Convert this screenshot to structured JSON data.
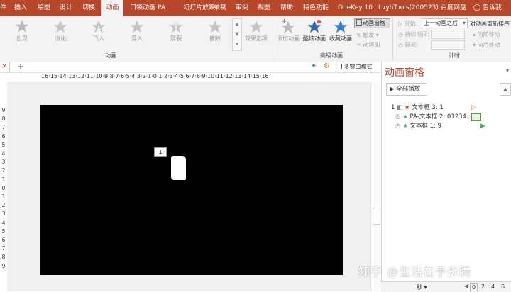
{
  "tabs": [
    {
      "label": "件",
      "active": false
    },
    {
      "label": "插入",
      "active": false
    },
    {
      "label": "绘图",
      "active": false
    },
    {
      "label": "设计",
      "active": false
    },
    {
      "label": "切换",
      "active": false
    },
    {
      "label": "动画",
      "active": true
    },
    {
      "label": "口袋动画 PA",
      "active": false
    },
    {
      "label": "幻灯片放映",
      "active": false
    },
    {
      "label": "录制",
      "active": false
    },
    {
      "label": "审阅",
      "active": false
    },
    {
      "label": "视图",
      "active": false
    },
    {
      "label": "帮助",
      "active": false
    },
    {
      "label": "特色功能",
      "active": false
    },
    {
      "label": "OneKey 10",
      "active": false
    },
    {
      "label": "LvyhTools(200523)",
      "active": false
    },
    {
      "label": "百度网盘",
      "active": false
    }
  ],
  "tellme": "告诉我",
  "ribbon": {
    "effects": [
      {
        "label": "出现"
      },
      {
        "label": "淡化"
      },
      {
        "label": "飞入"
      },
      {
        "label": "浮入"
      },
      {
        "label": "劈裂"
      },
      {
        "label": "擦除"
      }
    ],
    "effect_options": "效果选项",
    "group_animation": "动画",
    "add_animation": "添加动画",
    "cool_animation": "酷炫动画",
    "collect_animation": "收藏动画",
    "animation_pane": "动画窗格",
    "trigger": "触发",
    "animation_painter": "动画刷",
    "group_advanced": "高级动画",
    "start_label": "开始:",
    "start_value": "上一动画之后",
    "duration_label": "持续时间:",
    "delay_label": "延迟:",
    "group_timing": "计时",
    "reorder_title": "对动画重新排序",
    "move_earlier": "向前移动",
    "move_later": "向后移动"
  },
  "editor": {
    "multi_window": "多窗口模式",
    "hruler": "16·15·14·13·12·11·10·9·8·7·6·5·4·3·2·1·0·1·2·3·4·5·6·7·8·9·10·11·12·13·14·15·16",
    "vruler": [
      "9",
      "8",
      "7",
      "6",
      "5",
      "4",
      "3",
      "2",
      "1",
      "0",
      "1",
      "2",
      "3",
      "4",
      "5",
      "6",
      "7",
      "8",
      "9"
    ],
    "slide_tag": "1"
  },
  "pane": {
    "title": "动画窗格",
    "play_all": "全部播放",
    "items": [
      {
        "index": "1",
        "label": "文本框 3: 1"
      },
      {
        "index": "",
        "label": "PA-文本框 2: 01234..."
      },
      {
        "index": "",
        "label": "文本框 1: 9"
      }
    ],
    "seconds": "秒",
    "scale": [
      "0",
      "2",
      "4",
      "6"
    ]
  },
  "watermark": "知乎 @生活在于折腾",
  "colors": {
    "accent": "#b7472a",
    "star_red": "#c0392b",
    "star_green": "#3a8f6e"
  }
}
